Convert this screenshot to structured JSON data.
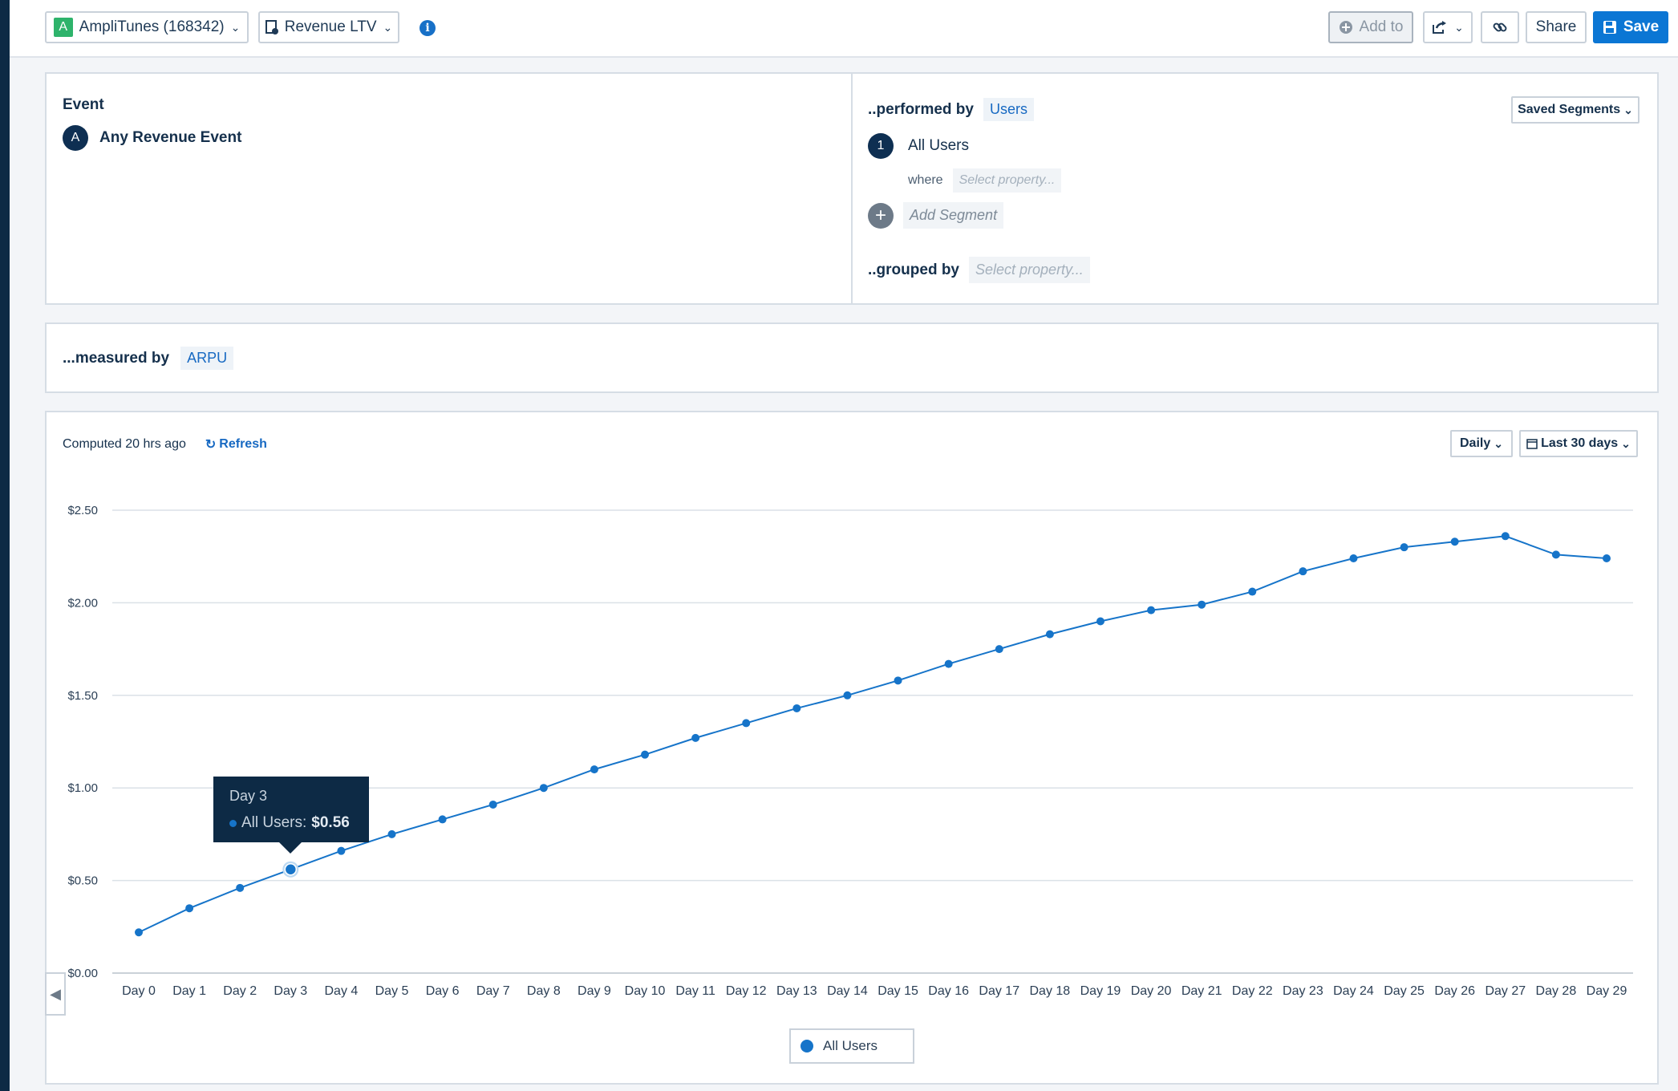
{
  "topbar": {
    "app_badge": "A",
    "app_name": "AmpliTunes (168342)",
    "chart_name": "Revenue LTV",
    "info": "i",
    "add_to_label": "Add to",
    "share_label": "Share",
    "save_label": "Save"
  },
  "event_panel": {
    "heading": "Event",
    "badge": "A",
    "event_name": "Any Revenue Event"
  },
  "segment_panel": {
    "performed_by_label": "..performed by",
    "performed_by_value": "Users",
    "saved_segments_label": "Saved Segments",
    "segment_number": "1",
    "segment_name": "All Users",
    "where_label": "where",
    "where_placeholder": "Select property...",
    "add_segment_label": "Add Segment",
    "grouped_by_label": "..grouped by",
    "grouped_by_placeholder": "Select property..."
  },
  "measured_panel": {
    "label": "...measured by",
    "value": "ARPU"
  },
  "chart_panel": {
    "computed_text": "Computed 20 hrs ago",
    "refresh_label": "Refresh",
    "interval_label": "Daily",
    "range_label": "Last 30 days"
  },
  "tooltip": {
    "title": "Day 3",
    "series_label": "All Users:",
    "value": "$0.56"
  },
  "legend": {
    "label": "All Users"
  },
  "colors": {
    "accent": "#0b76d4",
    "series": "#1674c9",
    "navy": "#0d2a45"
  },
  "chart_data": {
    "type": "line",
    "title": "",
    "xlabel": "",
    "ylabel": "",
    "categories": [
      "Day 0",
      "Day 1",
      "Day 2",
      "Day 3",
      "Day 4",
      "Day 5",
      "Day 6",
      "Day 7",
      "Day 8",
      "Day 9",
      "Day 10",
      "Day 11",
      "Day 12",
      "Day 13",
      "Day 14",
      "Day 15",
      "Day 16",
      "Day 17",
      "Day 18",
      "Day 19",
      "Day 20",
      "Day 21",
      "Day 22",
      "Day 23",
      "Day 24",
      "Day 25",
      "Day 26",
      "Day 27",
      "Day 28",
      "Day 29"
    ],
    "series": [
      {
        "name": "All Users",
        "values": [
          0.22,
          0.35,
          0.46,
          0.56,
          0.66,
          0.75,
          0.83,
          0.91,
          1.0,
          1.1,
          1.18,
          1.27,
          1.35,
          1.43,
          1.5,
          1.58,
          1.67,
          1.75,
          1.83,
          1.9,
          1.96,
          1.99,
          2.06,
          2.17,
          2.24,
          2.3,
          2.33,
          2.36,
          2.26,
          2.24
        ]
      }
    ],
    "yticks": [
      "$0.00",
      "$0.50",
      "$1.00",
      "$1.50",
      "$2.00",
      "$2.50"
    ],
    "ylim": [
      0,
      2.5
    ],
    "grid": true,
    "legend_position": "bottom-center",
    "highlighted_point": "Day 3"
  }
}
